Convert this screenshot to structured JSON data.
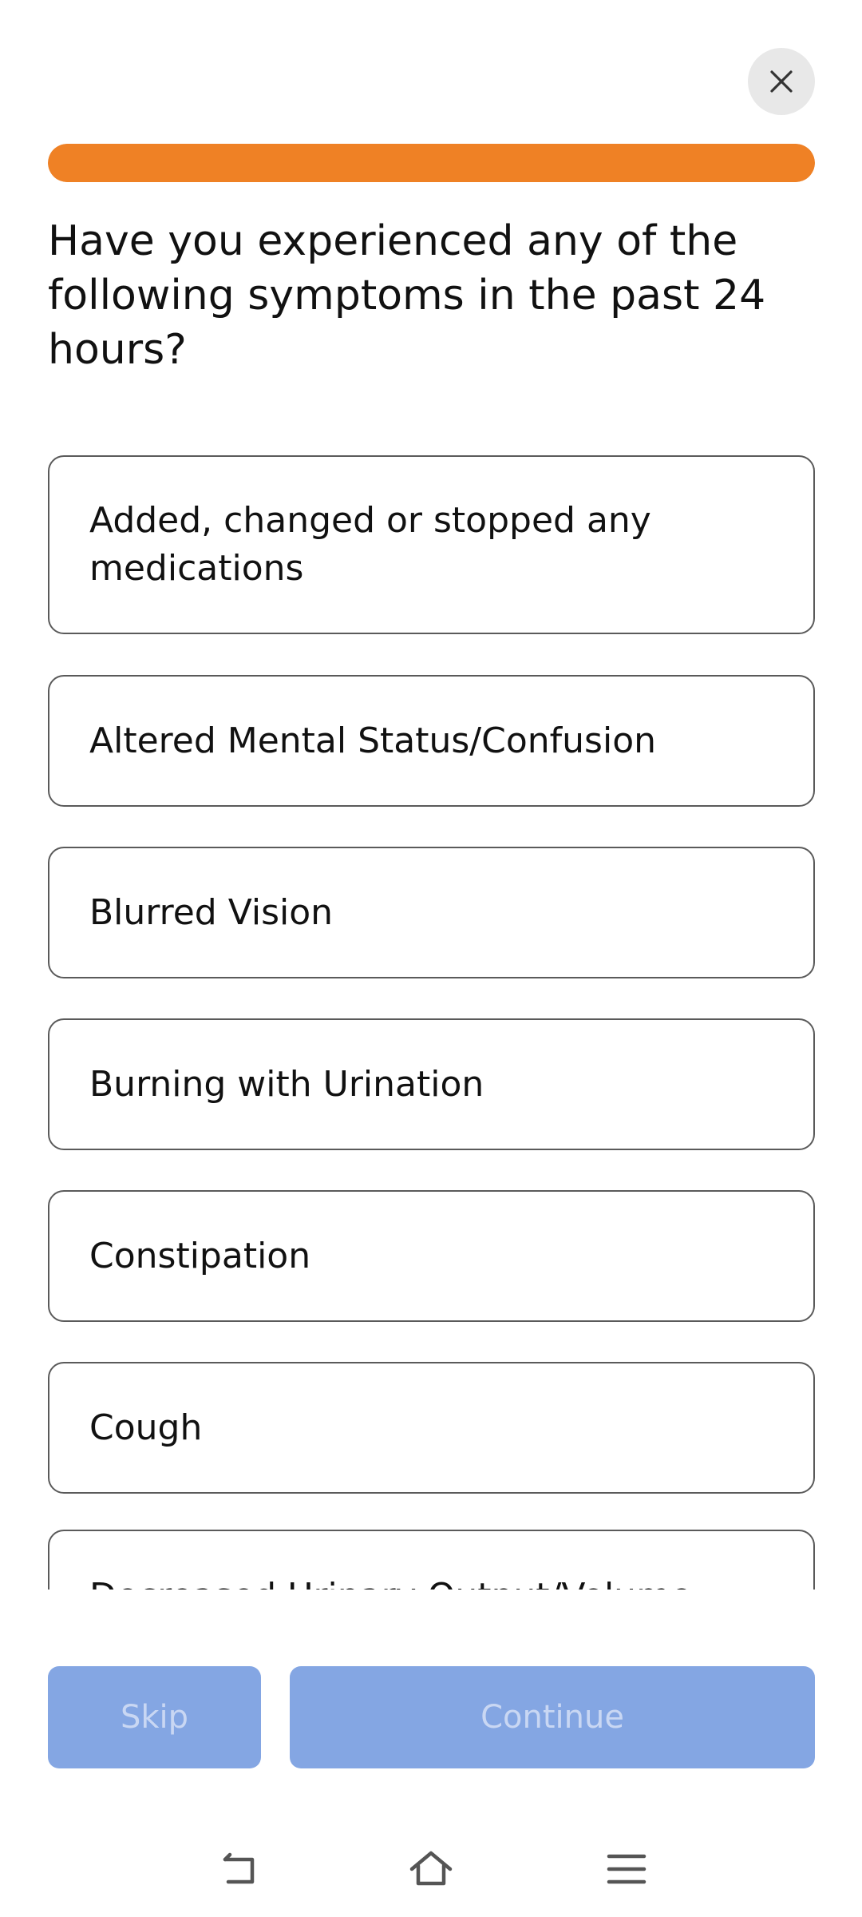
{
  "header": {
    "close_icon": "close-icon",
    "progress": 1.0,
    "progress_color": "#ef8125"
  },
  "question": {
    "text": "Have you experienced any of the following symptoms in the past 24 hours?"
  },
  "options": [
    {
      "label": "Added, changed or stopped any medications"
    },
    {
      "label": "Altered Mental Status/Confusion"
    },
    {
      "label": "Blurred Vision"
    },
    {
      "label": "Burning with Urination"
    },
    {
      "label": "Constipation"
    },
    {
      "label": "Cough"
    },
    {
      "label": "Decreased Urinary Output/Volume"
    }
  ],
  "footer": {
    "skip_label": "Skip",
    "continue_label": "Continue",
    "button_color": "#84a6e3"
  },
  "navbar": {
    "icons": [
      "back-icon",
      "home-icon",
      "menu-icon"
    ]
  }
}
